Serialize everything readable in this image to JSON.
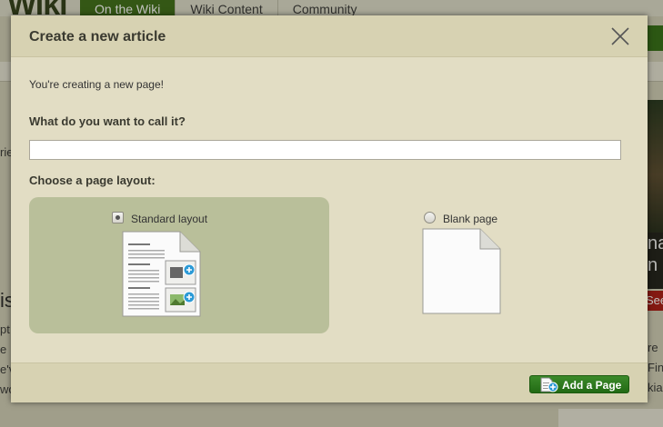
{
  "background_page": {
    "logo": "Wiki",
    "nav": [
      "On the Wiki",
      "Wiki Content",
      "Community"
    ],
    "right_dark_text": "nat n",
    "right_red_text": "See",
    "right_text_lines": [
      "re",
      "Fin",
      "kia"
    ],
    "left_text": "rie",
    "left_big_text": "is",
    "left_text_lines": [
      "pt",
      "e",
      "e'v",
      "wo"
    ]
  },
  "modal": {
    "title": "Create a new article",
    "intro": "You're creating a new page!",
    "name_question": "What do you want to call it?",
    "name_value": "",
    "layout_question": "Choose a page layout:",
    "layouts": [
      {
        "label": "Standard layout",
        "selected": true
      },
      {
        "label": "Blank page",
        "selected": false
      }
    ],
    "add_button_label": "Add a Page"
  },
  "colors": {
    "accent_green": "#2a7a1c",
    "modal_bg": "#e2ddc4",
    "selected_option_bg": "#b9bf9a"
  },
  "icons": [
    "close-icon",
    "standard-layout-page-icon",
    "blank-page-icon",
    "add-page-icon"
  ]
}
